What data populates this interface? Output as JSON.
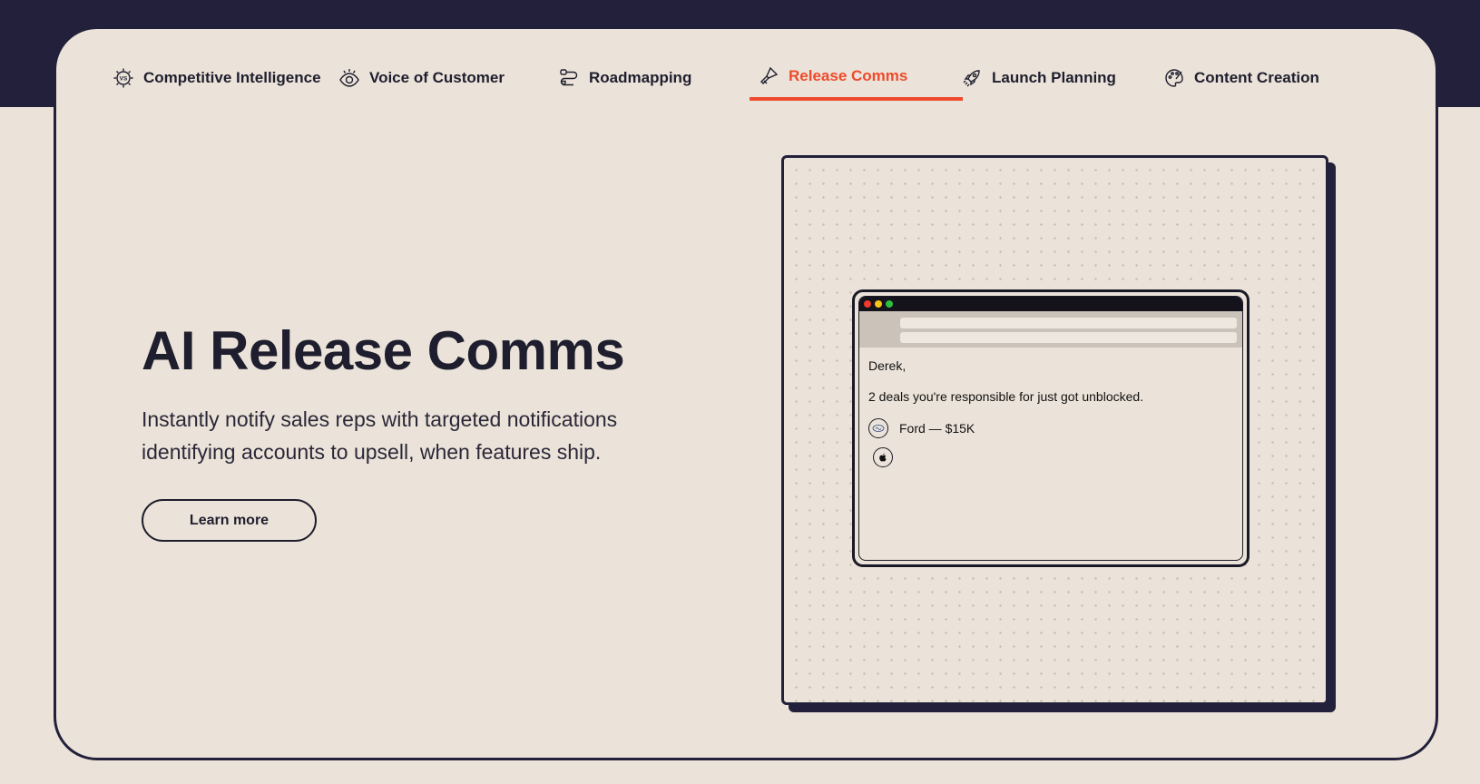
{
  "nav": {
    "tabs": [
      {
        "label": "Competitive Intelligence",
        "icon": "vs-badge-icon"
      },
      {
        "label": "Voice of Customer",
        "icon": "eye-icon"
      },
      {
        "label": "Roadmapping",
        "icon": "route-icon"
      },
      {
        "label": "Release Comms",
        "icon": "megaphone-icon",
        "active": true
      },
      {
        "label": "Launch Planning",
        "icon": "rocket-icon"
      },
      {
        "label": "Content Creation",
        "icon": "palette-icon"
      }
    ]
  },
  "hero": {
    "title": "AI Release Comms",
    "description": "Instantly notify sales reps with targeted notifications identifying accounts to upsell, when features ship.",
    "cta_label": "Learn more"
  },
  "email": {
    "greeting": "Derek,",
    "message": "2 deals you're responsible for just got unblocked.",
    "deals": [
      {
        "label": "Ford — $15K",
        "logo": "ford-logo-icon"
      },
      {
        "label": "",
        "logo": "apple-logo-icon"
      }
    ]
  },
  "colors": {
    "accent": "#ee4a2b",
    "dark": "#22203a",
    "background": "#ebe3d9"
  }
}
